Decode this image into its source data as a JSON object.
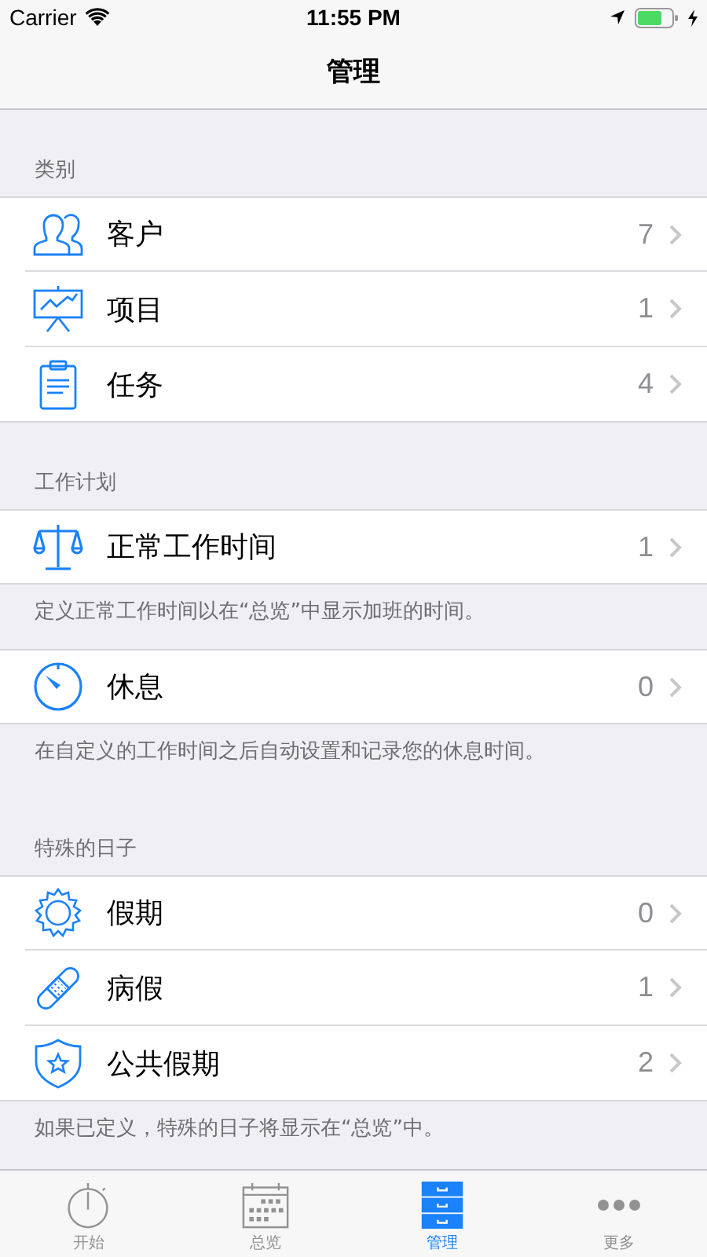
{
  "status_bar": {
    "carrier": "Carrier",
    "time": "11:55 PM"
  },
  "nav_bar": {
    "title": "管理"
  },
  "groups": [
    {
      "header": "类别",
      "rows": [
        {
          "kind": "people",
          "label": "客户",
          "count": "7"
        },
        {
          "kind": "easel",
          "label": "项目",
          "count": "1"
        },
        {
          "kind": "clipboard",
          "label": "任务",
          "count": "4"
        }
      ]
    },
    {
      "header": "工作计划",
      "rows": [
        {
          "kind": "scale",
          "label": "正常工作时间",
          "count": "1"
        }
      ],
      "footer": "定义正常工作时间以在“总览”中显示加班的时间。"
    },
    {
      "rows": [
        {
          "kind": "timer",
          "label": "休息",
          "count": "0"
        }
      ],
      "footer": "在自定义的工作时间之后自动设置和记录您的休息时间。"
    },
    {
      "header": "特殊的日子",
      "rows": [
        {
          "kind": "sun",
          "label": "假期",
          "count": "0"
        },
        {
          "kind": "bandage",
          "label": "病假",
          "count": "1"
        },
        {
          "kind": "shield",
          "label": "公共假期",
          "count": "2"
        }
      ],
      "footer": "如果已定义，特殊的日子将显示在“总览”中。"
    }
  ],
  "tab_bar": [
    {
      "kind": "stopwatch",
      "label": "开始",
      "selected": false
    },
    {
      "kind": "calendar",
      "label": "总览",
      "selected": false
    },
    {
      "kind": "cabinet",
      "label": "管理",
      "selected": true
    },
    {
      "kind": "dots",
      "label": "更多",
      "selected": false
    }
  ]
}
